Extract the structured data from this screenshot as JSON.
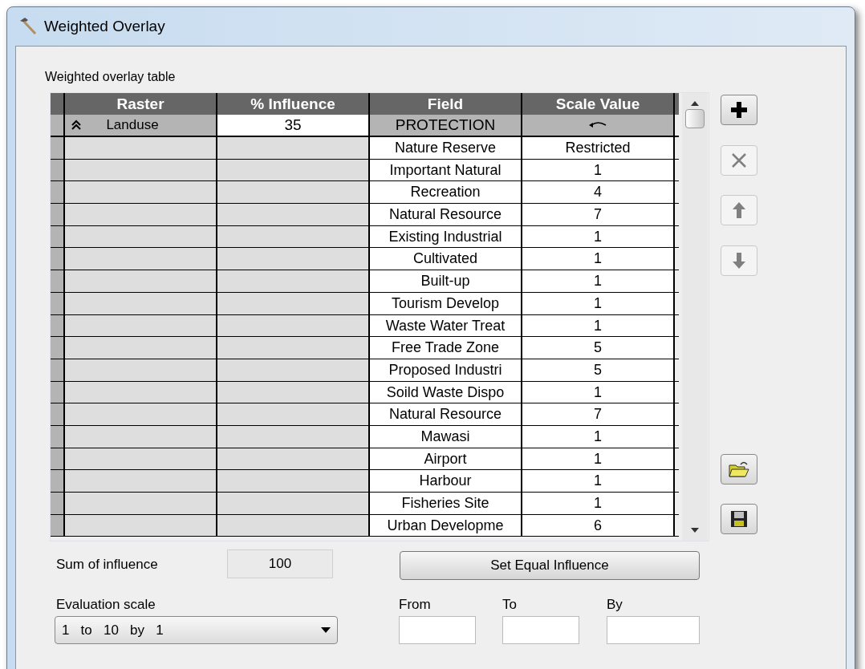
{
  "window": {
    "title": "Weighted Overlay"
  },
  "table_label": "Weighted overlay table",
  "table": {
    "columns": [
      "Raster",
      "% Influence",
      "Field",
      "Scale Value"
    ],
    "raster_row": {
      "raster": "Landuse",
      "influence": "35",
      "field": "PROTECTION",
      "expanded": true
    },
    "rows": [
      {
        "field": "Nature Reserve",
        "scale_value": "Restricted"
      },
      {
        "field": "Important Natural",
        "scale_value": "1"
      },
      {
        "field": "Recreation",
        "scale_value": "4"
      },
      {
        "field": "Natural Resource",
        "scale_value": "7"
      },
      {
        "field": "Existing Industrial",
        "scale_value": "1"
      },
      {
        "field": "Cultivated",
        "scale_value": "1"
      },
      {
        "field": "Built-up",
        "scale_value": "1"
      },
      {
        "field": "Tourism Develop",
        "scale_value": "1"
      },
      {
        "field": "Waste Water Treat",
        "scale_value": "1"
      },
      {
        "field": "Free Trade Zone",
        "scale_value": "5"
      },
      {
        "field": "Proposed Industri",
        "scale_value": "5"
      },
      {
        "field": "Soild Waste Dispo",
        "scale_value": "1"
      },
      {
        "field": "Natural Resource",
        "scale_value": "7"
      },
      {
        "field": "Mawasi",
        "scale_value": "1"
      },
      {
        "field": "Airport",
        "scale_value": "1"
      },
      {
        "field": "Harbour",
        "scale_value": "1"
      },
      {
        "field": "Fisheries Site",
        "scale_value": "1"
      },
      {
        "field": "Urban Developme",
        "scale_value": "6"
      }
    ]
  },
  "side_buttons": [
    {
      "kind": "add",
      "disabled": false
    },
    {
      "kind": "remove",
      "disabled": true
    },
    {
      "kind": "up",
      "disabled": true
    },
    {
      "kind": "down",
      "disabled": true
    },
    {
      "kind": "open",
      "disabled": false
    },
    {
      "kind": "save",
      "disabled": false
    }
  ],
  "sum_label": "Sum of influence",
  "sum_value": "100",
  "equal_button": "Set Equal Influence",
  "scale_label": "Evaluation scale",
  "scale_value": "1   to   10   by   1",
  "range_fields": [
    {
      "label": "From"
    },
    {
      "label": "To"
    },
    {
      "label": "By"
    }
  ]
}
